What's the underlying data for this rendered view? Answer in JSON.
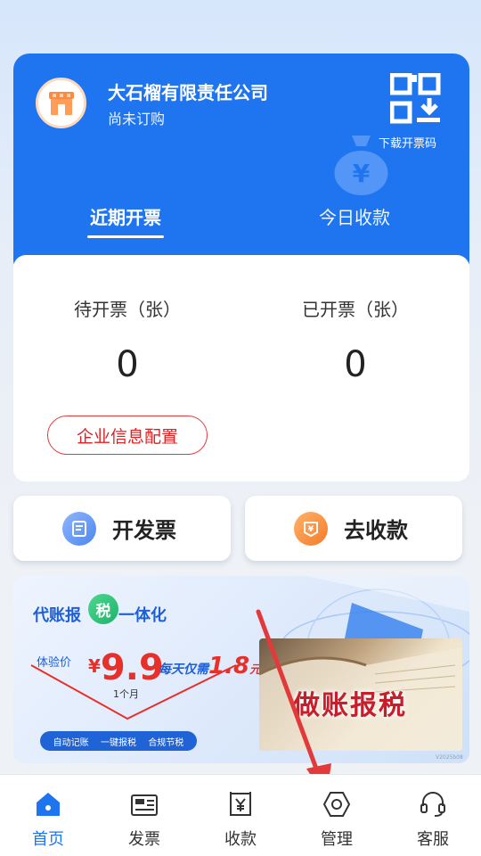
{
  "header": {
    "company_name": "大石榴有限责任公司",
    "subscription_status": "尚未订购",
    "qr_label": "下载开票码",
    "tabs": [
      {
        "label": "近期开票",
        "active": true
      },
      {
        "label": "今日收款",
        "active": false
      }
    ]
  },
  "stats": {
    "pending_label": "待开票（张）",
    "pending_value": "0",
    "issued_label": "已开票（张）",
    "issued_value": "0",
    "config_button": "企业信息配置"
  },
  "actions": {
    "invoice_label": "开发票",
    "collect_label": "去收款"
  },
  "banner": {
    "title_left": "代账报",
    "badge": "税",
    "title_right": "一体化",
    "trial_label": "体验价",
    "currency": "¥",
    "price": "9.9",
    "price_unit": "1个月",
    "daily_text": "每天仅需",
    "daily_price": "1.8",
    "daily_unit": "元",
    "tags": [
      "自动记账",
      "一键报税",
      "合规节税"
    ],
    "book_text": "做账报税",
    "version": "V2025b08"
  },
  "tabbar": [
    {
      "label": "首页",
      "icon": "home-icon",
      "active": true
    },
    {
      "label": "发票",
      "icon": "invoice-icon",
      "active": false
    },
    {
      "label": "收款",
      "icon": "receipt-icon",
      "active": false
    },
    {
      "label": "管理",
      "icon": "settings-hexagon-icon",
      "active": false
    },
    {
      "label": "客服",
      "icon": "headset-icon",
      "active": false
    }
  ],
  "colors": {
    "primary": "#1f75f0",
    "danger": "#e02020",
    "annotation_arrow": "#e23a3a"
  }
}
